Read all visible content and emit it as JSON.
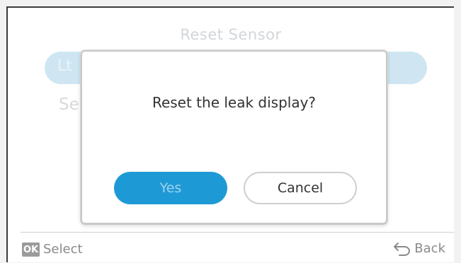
{
  "background": {
    "title": "Reset Sensor",
    "highlighted_item": "Lt",
    "second_item": "Se"
  },
  "dialog": {
    "message": "Reset the leak display?",
    "yes_label": "Yes",
    "cancel_label": "Cancel"
  },
  "footer": {
    "ok_key": "OK",
    "select_label": "Select",
    "back_label": "Back",
    "back_icon": "back-arrow-icon"
  },
  "colors": {
    "accent": "#1d9ad6",
    "yes_text": "#9fd2ee",
    "muted": "#8a8a8a"
  }
}
